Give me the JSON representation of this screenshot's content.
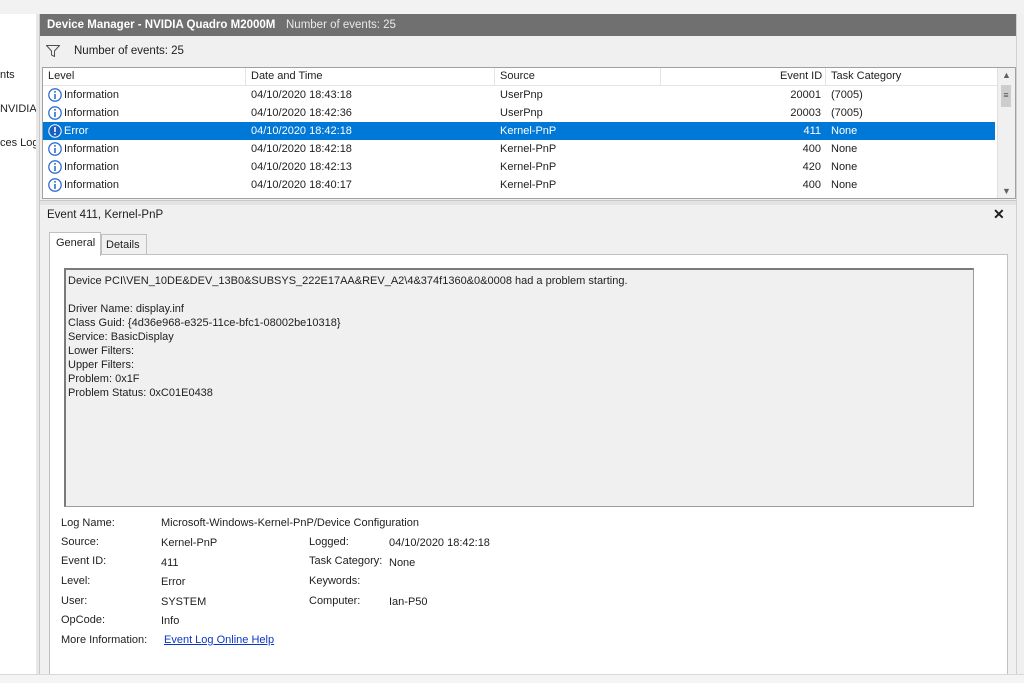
{
  "left_pane": {
    "items": [
      "nts",
      "NVIDIA",
      "ces Log"
    ]
  },
  "title_bar": {
    "title": "Device Manager - NVIDIA Quadro M2000M",
    "event_count": "Number of events: 25"
  },
  "filter_bar": {
    "icon": "funnel-icon",
    "label": "Number of events: 25"
  },
  "grid": {
    "columns": {
      "level": "Level",
      "date_time": "Date and Time",
      "source": "Source",
      "event_id": "Event ID",
      "task_category": "Task Category"
    },
    "rows": [
      {
        "icon": "information-icon",
        "level": "Information",
        "date_time": "04/10/2020 18:43:18",
        "source": "UserPnp",
        "event_id": "20001",
        "task_category": "(7005)"
      },
      {
        "icon": "information-icon",
        "level": "Information",
        "date_time": "04/10/2020 18:42:36",
        "source": "UserPnp",
        "event_id": "20003",
        "task_category": "(7005)"
      },
      {
        "icon": "error-icon",
        "level": "Error",
        "date_time": "04/10/2020 18:42:18",
        "source": "Kernel-PnP",
        "event_id": "411",
        "task_category": "None",
        "selected": true
      },
      {
        "icon": "information-icon",
        "level": "Information",
        "date_time": "04/10/2020 18:42:18",
        "source": "Kernel-PnP",
        "event_id": "400",
        "task_category": "None"
      },
      {
        "icon": "information-icon",
        "level": "Information",
        "date_time": "04/10/2020 18:42:13",
        "source": "Kernel-PnP",
        "event_id": "420",
        "task_category": "None"
      },
      {
        "icon": "information-icon",
        "level": "Information",
        "date_time": "04/10/2020 18:40:17",
        "source": "Kernel-PnP",
        "event_id": "400",
        "task_category": "None"
      }
    ]
  },
  "detail": {
    "header": "Event 411, Kernel-PnP",
    "tabs": {
      "general": "General",
      "details": "Details"
    },
    "description": {
      "line1": "Device PCI\\VEN_10DE&DEV_13B0&SUBSYS_222E17AA&REV_A2\\4&374f1360&0&0008 had a problem starting.",
      "line2": "Driver Name: display.inf",
      "line3": "Class Guid: {4d36e968-e325-11ce-bfc1-08002be10318}",
      "line4": "Service: BasicDisplay",
      "line5": "Lower Filters:",
      "line6": "Upper Filters:",
      "line7": "Problem: 0x1F",
      "line8": "Problem Status: 0xC01E0438"
    },
    "props": {
      "log_name_label": "Log Name:",
      "log_name_value": "Microsoft-Windows-Kernel-PnP/Device Configuration",
      "source_label": "Source:",
      "source_value": "Kernel-PnP",
      "logged_label": "Logged:",
      "logged_value": "04/10/2020 18:42:18",
      "event_id_label": "Event ID:",
      "event_id_value": "411",
      "task_category_label": "Task Category:",
      "task_category_value": "None",
      "level_label": "Level:",
      "level_value": "Error",
      "keywords_label": "Keywords:",
      "user_label": "User:",
      "user_value": "SYSTEM",
      "computer_label": "Computer:",
      "computer_value": "Ian-P50",
      "opcode_label": "OpCode:",
      "opcode_value": "Info",
      "more_info_label": "More Information:",
      "more_info_link": "Event Log Online Help"
    }
  },
  "colors": {
    "title_bar": "#707070",
    "selection": "#0078d7",
    "link": "#0a36c8",
    "info_icon": "#2e6fd1",
    "error_icon": "#1c5fc4"
  }
}
